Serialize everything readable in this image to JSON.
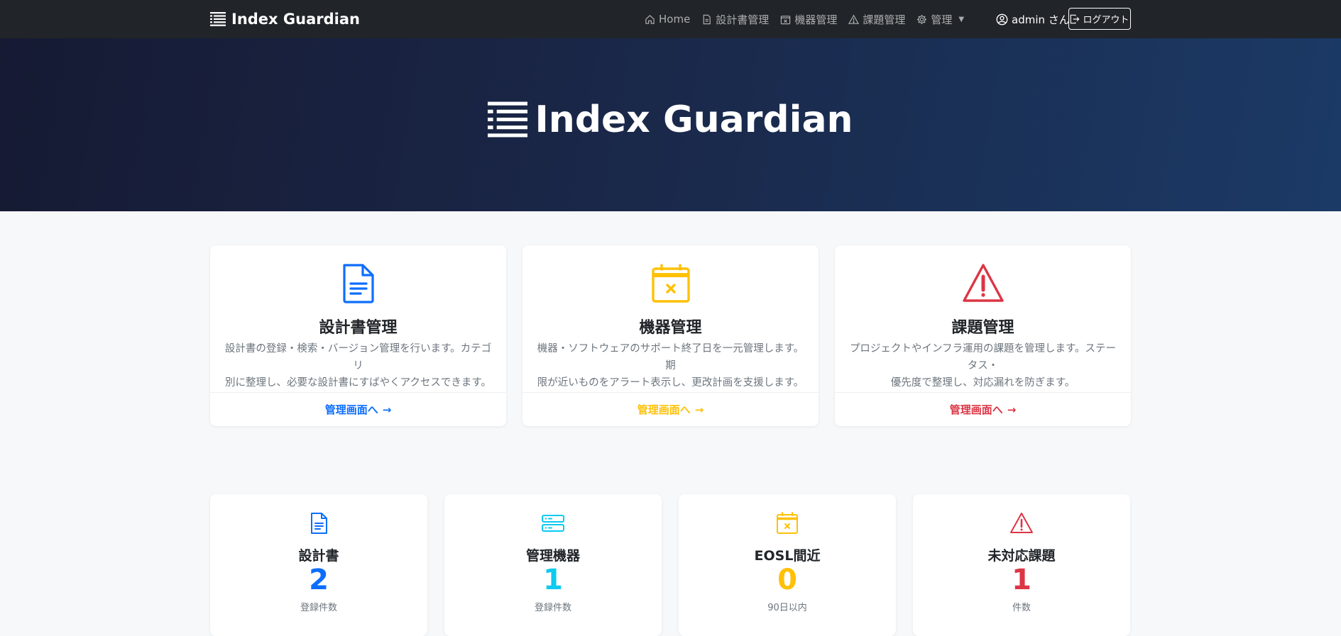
{
  "brand": {
    "name": "Index Guardian"
  },
  "nav": {
    "home": "Home",
    "docs": "設計書管理",
    "devices": "機器管理",
    "issues": "課題管理",
    "admin": "管理"
  },
  "user": {
    "label": "admin さん",
    "logout": "ログアウト"
  },
  "hero": {
    "title": "Index Guardian"
  },
  "features": [
    {
      "title": "設計書管理",
      "desc_line1": "設計書の登録・検索・バージョン管理を行います。カテゴリ",
      "desc_line2": "別に整理し、必要な設計書にすばやくアクセスできます。",
      "link": "管理画面へ"
    },
    {
      "title": "機器管理",
      "desc_line1": "機器・ソフトウェアのサポート終了日を一元管理します。期",
      "desc_line2": "限が近いものをアラート表示し、更改計画を支援します。",
      "link": "管理画面へ"
    },
    {
      "title": "課題管理",
      "desc_line1": "プロジェクトやインフラ運用の課題を管理します。ステータス・",
      "desc_line2": "優先度で整理し、対応漏れを防ぎます。",
      "link": "管理画面へ"
    }
  ],
  "stats": [
    {
      "title": "設計書",
      "value": "2",
      "sub": "登録件数"
    },
    {
      "title": "管理機器",
      "value": "1",
      "sub": "登録件数"
    },
    {
      "title": "EOSL間近",
      "value": "0",
      "sub": "90日以内"
    },
    {
      "title": "未対応課題",
      "value": "1",
      "sub": "件数"
    }
  ],
  "colors": {
    "blue": "#0d6efd",
    "yellow": "#ffc107",
    "red": "#dc3545",
    "cyan": "#0dcaf0"
  },
  "icons": {
    "brand": "text-indent-icon",
    "docs": "file-text-icon",
    "devices": "calendar-x-icon",
    "issues": "exclamation-triangle-icon",
    "servers": "hdd-stack-icon"
  }
}
